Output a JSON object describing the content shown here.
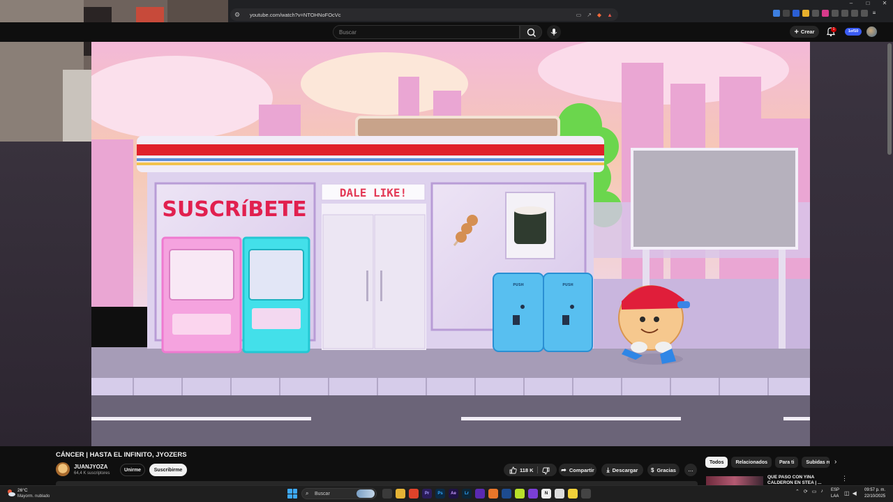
{
  "browser": {
    "url": "youtube.com/watch?v=NTOHNoFOcVc"
  },
  "youtube": {
    "search_placeholder": "Buscar",
    "create_label": "Crear",
    "notification_count": "1",
    "account_pill": "1of10"
  },
  "game": {
    "sign_subscribe": "SUSCRíBETE",
    "sign_like": "DALE LIKE!",
    "bin_label": "PUSH",
    "colors": {
      "sky_top": "#f3b9d8",
      "awning_red": "#e0202a",
      "road": "#6b6478",
      "bin": "#58bff0"
    }
  },
  "video": {
    "title": "CÁNCER | HASTA EL INFINITO, JYOZERS",
    "channel_name": "JUANJYOZA",
    "subscribers": "64,4 K suscriptores",
    "join_label": "Unirme",
    "subscribe_label": "Suscribirme",
    "likes": "118 K",
    "share_label": "Compartir",
    "download_label": "Descargar",
    "thanks_label": "Gracias",
    "more": "..."
  },
  "sidebar": {
    "chips": [
      "Todos",
      "Relacionados",
      "Para ti",
      "Subidas rec"
    ],
    "rec_title": "QUE PASO CON YINA CALDERON EN STEA | ..."
  },
  "taskbar": {
    "temperature": "26°C",
    "weather": "Mayorm. nublado",
    "search_label": "Buscar",
    "lang_line1": "ESP",
    "lang_line2": "LAA",
    "time": "09:57 p. m.",
    "date": "22/10/2025"
  }
}
